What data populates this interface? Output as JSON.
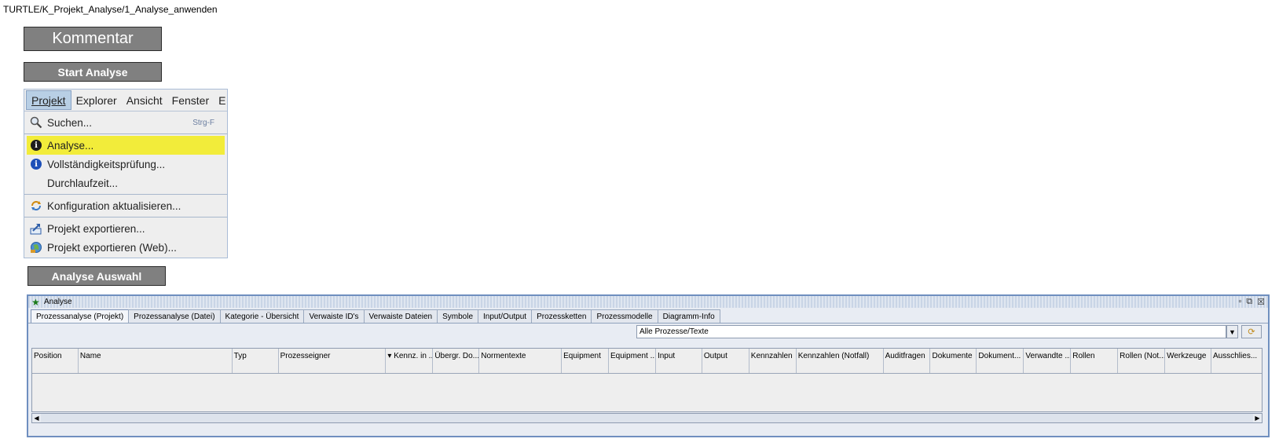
{
  "breadcrumb": "TURTLE/K_Projekt_Analyse/1_Analyse_anwenden",
  "buttons": {
    "kommentar": "Kommentar",
    "start_analyse": "Start Analyse",
    "analyse_auswahl": "Analyse Auswahl"
  },
  "menubar": {
    "items": [
      "Projekt",
      "Explorer",
      "Ansicht",
      "Fenster",
      "E"
    ]
  },
  "menu": {
    "suchen": "Suchen...",
    "suchen_shortcut": "Strg-F",
    "analyse": "Analyse...",
    "vollstaendigkeit": "Vollständigkeitsprüfung...",
    "durchlaufzeit": "Durchlaufzeit...",
    "konfiguration": "Konfiguration aktualisieren...",
    "exportieren": "Projekt exportieren...",
    "exportieren_web": "Projekt exportieren (Web)..."
  },
  "window": {
    "title": "Analyse",
    "tabs": [
      "Prozessanalyse (Projekt)",
      "Prozessanalyse (Datei)",
      "Kategorie - Übersicht",
      "Verwaiste ID's",
      "Verwaiste Dateien",
      "Symbole",
      "Input/Output",
      "Prozessketten",
      "Prozessmodelle",
      "Diagramm-Info"
    ],
    "filter_value": "Alle Prozesse/Texte",
    "columns": [
      "Position",
      "Name",
      "Typ",
      "Prozesseigner",
      "▾ Kennz. in ...",
      "Übergr. Do...",
      "Normentexte",
      "Equipment",
      "Equipment ...",
      "Input",
      "Output",
      "Kennzahlen",
      "Kennzahlen (Notfall)",
      "Auditfragen",
      "Dokumente",
      "Dokument...",
      "Verwandte ...",
      "Rollen",
      "Rollen (Not...",
      "Werkzeuge",
      "Ausschlies..."
    ]
  },
  "colors": {
    "button_gray": "#808080",
    "highlight_yellow": "#f2ec3a",
    "window_border": "#6f8fbf"
  }
}
